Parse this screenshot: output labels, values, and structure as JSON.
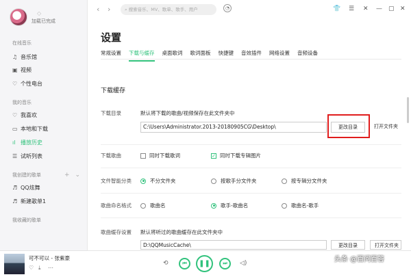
{
  "sidebar": {
    "load_status": "加载已完成",
    "sections": [
      {
        "title": "在线音乐",
        "items": [
          {
            "icon": "music-hall-icon",
            "label": "音乐馆"
          },
          {
            "icon": "video-icon",
            "label": "视频"
          },
          {
            "icon": "radio-icon",
            "label": "个性电台"
          }
        ]
      },
      {
        "title": "我的音乐",
        "items": [
          {
            "icon": "heart-icon",
            "label": "我喜欢"
          },
          {
            "icon": "monitor-icon",
            "label": "本地和下载"
          },
          {
            "icon": "history-icon",
            "label": "播放历史"
          },
          {
            "icon": "trial-icon",
            "label": "试听列表"
          }
        ]
      },
      {
        "title": "我创建的歌单",
        "items": [
          {
            "icon": "playlist-icon",
            "label": "QQ炫舞"
          },
          {
            "icon": "playlist-icon",
            "label": "新建歌单1"
          }
        ]
      },
      {
        "title": "我收藏的歌单",
        "items": []
      }
    ]
  },
  "search": {
    "placeholder": "搜索音乐、MV、歌单、歌手、用户"
  },
  "page_title": "设置",
  "tabs": [
    "常规设置",
    "下载与缓存",
    "桌面歌词",
    "歌词面板",
    "快捷键",
    "音效插件",
    "网络设置",
    "音频设备"
  ],
  "active_tab": "下载与缓存",
  "download": {
    "section_title": "下载缓存",
    "dir_label": "下载目录",
    "dir_desc": "默认将下载的歌曲/视频保存在此文件夹中",
    "dir_path": "C:\\Users\\Administrator.2013-20180905CG\\Desktop\\",
    "change_dir": "更改目录",
    "open_folder": "打开文件夹",
    "song_label": "下载歌曲",
    "opt_lyrics": "同时下载歌词",
    "opt_cover": "同时下载专辑图片",
    "classify_label": "文件智能分类",
    "classify_opts": [
      "不分文件夹",
      "按歌手分文件夹",
      "按专辑分文件夹"
    ],
    "naming_label": "歌曲命名格式",
    "naming_opts": [
      "歌曲名",
      "歌手-歌曲名",
      "歌曲名-歌手"
    ],
    "cache_label": "歌曲缓存设置",
    "cache_desc": "默认将听过的歌曲缓存在此文件夹中",
    "cache_path": "D:\\QQMusicCache\\",
    "change_dir2": "更改目录",
    "open_folder2": "打开文件夹"
  },
  "player": {
    "song": "可不可以 - 张紫豪"
  },
  "watermark": "头条 @百问百答",
  "colors": {
    "accent": "#31c27c",
    "highlight": "#e01c1c"
  }
}
